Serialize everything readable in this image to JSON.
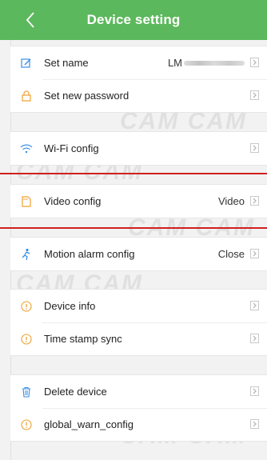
{
  "header": {
    "title": "Device setting"
  },
  "groups": [
    [
      {
        "icon": "edit-icon",
        "label": "Set name",
        "value_prefix": "LM",
        "masked": true
      },
      {
        "icon": "lock-icon",
        "label": "Set new password"
      }
    ],
    [
      {
        "icon": "wifi-icon",
        "label": "Wi-Fi config"
      }
    ],
    [
      {
        "icon": "sd-card-icon",
        "label": "Video config",
        "value": "Video"
      }
    ],
    [
      {
        "icon": "running-person-icon",
        "label": "Motion alarm config",
        "value": "Close"
      }
    ],
    [
      {
        "icon": "info-icon",
        "label": "Device info"
      },
      {
        "icon": "info-icon",
        "label": "Time stamp sync"
      }
    ],
    [
      {
        "icon": "trash-icon",
        "label": "Delete device"
      },
      {
        "icon": "info-icon",
        "label": "global_warn_config"
      }
    ]
  ],
  "watermark": {
    "text": "CAM CAM"
  },
  "colors": {
    "header": "#5cb85c",
    "accent_blue": "#3a8ee6",
    "accent_orange": "#f0a030",
    "redline": "#d21f1f"
  }
}
